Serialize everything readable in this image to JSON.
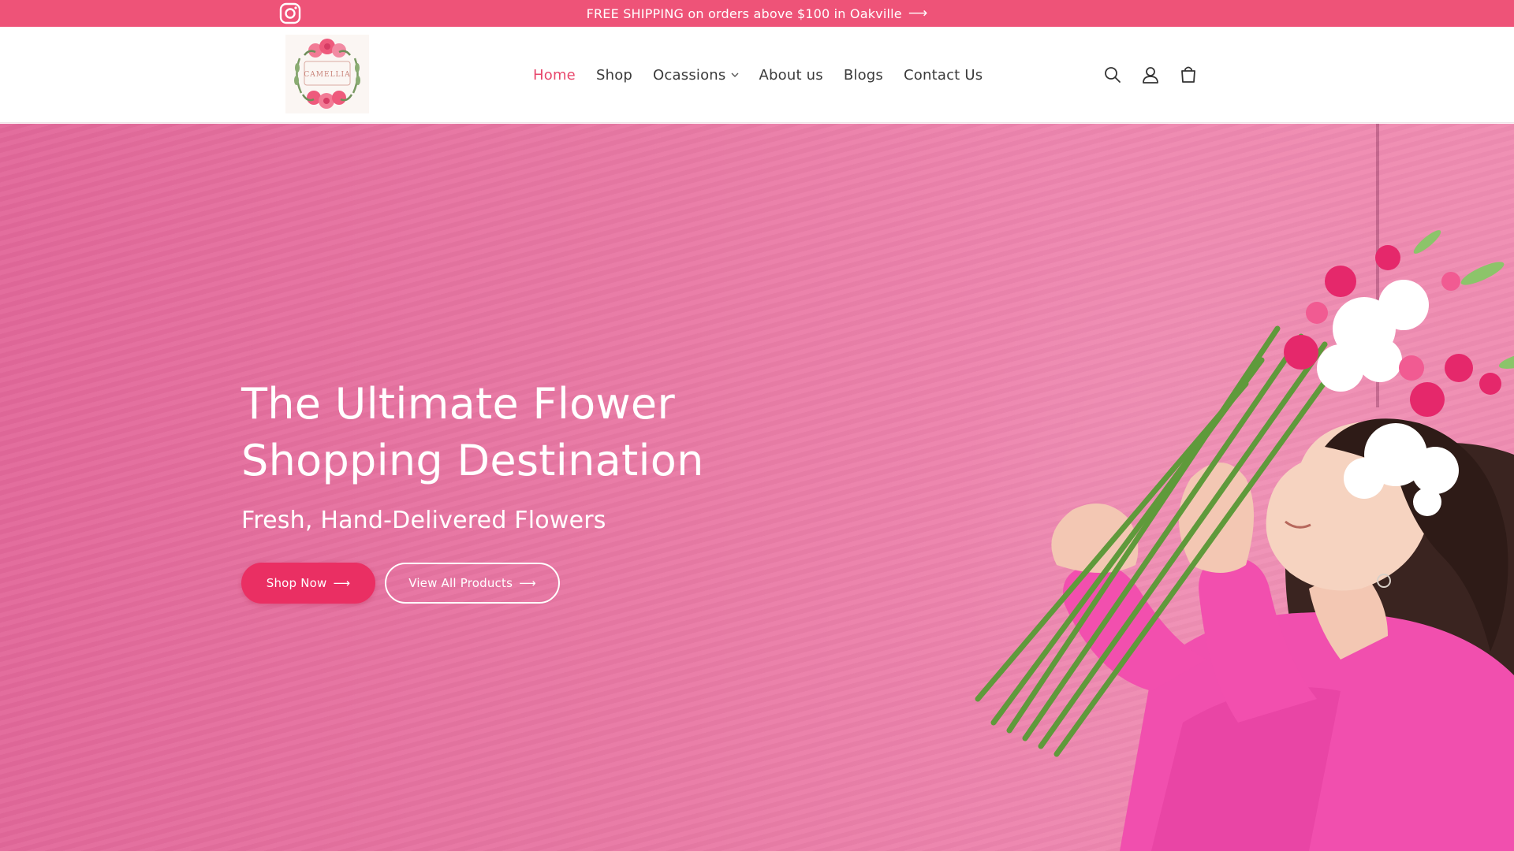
{
  "announcement": {
    "text": "FREE SHIPPING on orders above $100 in Oakville",
    "arrow": "⟶",
    "social_icon": "instagram-icon",
    "background": "#ee5378"
  },
  "header": {
    "logo_text": "CAMELLIA",
    "nav": [
      {
        "label": "Home",
        "active": true
      },
      {
        "label": "Shop"
      },
      {
        "label": "Ocassions",
        "dropdown": true
      },
      {
        "label": "About us"
      },
      {
        "label": "Blogs"
      },
      {
        "label": "Contact Us"
      }
    ],
    "dropdown_icon": "chevron-down-icon",
    "icons": [
      "search-icon",
      "account-icon",
      "cart-icon"
    ],
    "active_color": "#e8476c"
  },
  "hero": {
    "title_line1": "The Ultimate Flower",
    "title_line2": "Shopping Destination",
    "subtitle": "Fresh, Hand-Delivered Flowers",
    "primary_button": "Shop Now",
    "secondary_button": "View All Products",
    "button_arrow": "⟶",
    "primary_color": "#ea2f63",
    "background": "#e97aa5"
  }
}
